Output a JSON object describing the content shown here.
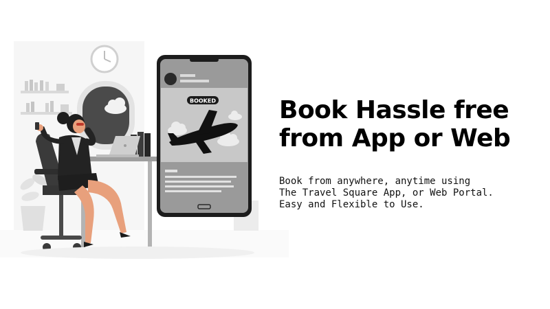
{
  "headline": {
    "line1": "Book Hassle free",
    "line2": "from App or Web"
  },
  "description": {
    "line1": "Book from anywhere, anytime using",
    "line2": "The Travel Square App, or Web Portal.",
    "line3": "Easy and Flexible to Use."
  },
  "phone_screen": {
    "badge_label": "BOOKED"
  },
  "colors": {
    "text": "#000000",
    "phone_body": "#1c1c1c",
    "screen_bg": "#9a9a9a",
    "screen_panel": "#c8c8c8",
    "illustration_gray": "#e6e6e6",
    "chair": "#3a3a3a",
    "skin": "#e8a07c",
    "glasses_red": "#c0392b"
  },
  "icons": [
    "wall-clock-icon",
    "airplane-icon",
    "cloud-icon",
    "laptop-icon",
    "plant-icon"
  ]
}
